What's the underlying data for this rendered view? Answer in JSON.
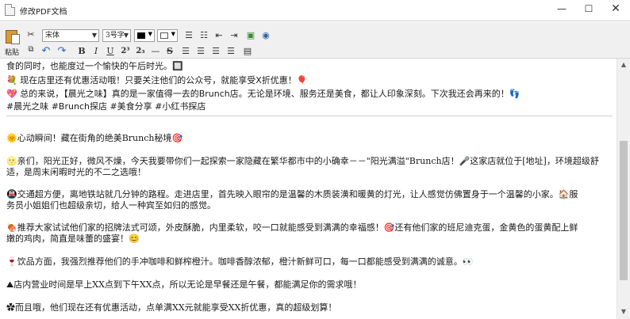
{
  "window": {
    "title": "修改PDF文档",
    "minimize": "—",
    "maximize": "☐",
    "close": "✕"
  },
  "toolbar": {
    "paste_label": "粘贴",
    "font_name": "宋体",
    "font_size": "3号字",
    "text_color": "#000000",
    "bg_color": "#ffffff",
    "bold": "B",
    "italic": "I",
    "underline": "U",
    "superscript": "2³",
    "subscript": "2₃",
    "strike": "S"
  },
  "editor": {
    "lines": [
      "食的同时，也能度过一个愉快的午后时光。🔲",
      "💐 现在店里还有优惠活动哦！只要关注他们的公众号，就能享受X折优惠！🎈",
      "💖 总的来说，【晨光之味】真的是一家值得一去的Brunch店。无论是环境、服务还是美食，都让人印象深刻。下次我还会再来的！👣",
      "#晨光之味 #Brunch探店 #美食分享 #小红书探店",
      "🌞心动瞬间！藏在街角的绝美Brunch秘境🎯",
      "🌝亲们，阳光正好，微风不燥，今天我要带你们一起探索一家隐藏在繁华都市中的小确幸－－\"阳光满溢\"Brunch店！🎤这家店就位于[地址]，环境超级舒",
      "适，是周末闲暇时光的不二之选哦！",
      "🚇交通超方便，离地铁站就几分钟的路程。走进店里，首先映入眼帘的是温馨的木质装潢和暖黄的灯光，让人感觉仿佛置身于一个温馨的小家。🏠服",
      "务员小姐姐们也超级亲切，给人一种宾至如归的感觉。",
      "🍖推荐大家试试他们家的招牌法式可颂，外皮酥脆，内里柔软，咬一口就能感受到满满的幸福感！🎯还有他们家的班尼迪克蛋，金黄色的蛋黄配上鲜",
      "嫩的鸡肉，简直是味蕾的盛宴！😊",
      "🍷饮品方面，我强烈推荐他们的手冲咖啡和鲜榨橙汁。咖啡香醇浓郁，橙汁新鲜可口，每一口都能感受到满满的诚意。👀",
      "⛰店内营业时间是早上XX点到下午XX点，所以无论是早餐还是午餐，都能满足你的需求哦！",
      "✿而且哦，他们现在还有优惠活动，点单满XX元就能享受XX折优惠，真的超级划算！"
    ]
  },
  "scrollbar": {
    "up": "▲",
    "down": "▼"
  }
}
